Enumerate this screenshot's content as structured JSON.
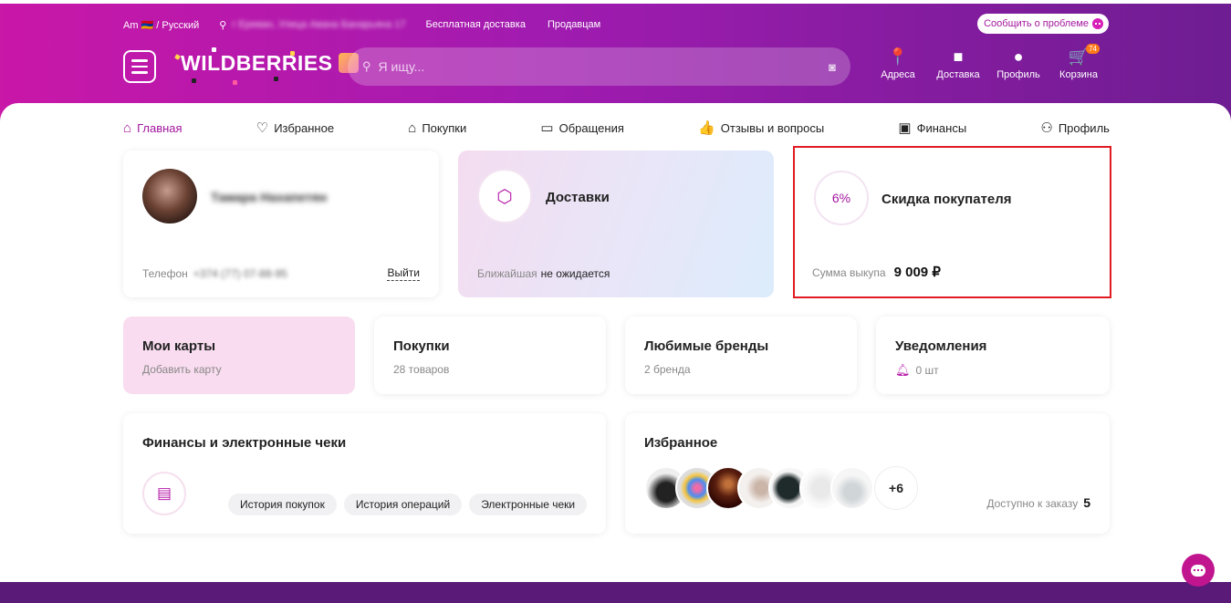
{
  "header": {
    "lang": "Am 🇦🇲 / Русский",
    "address": "г Ереван, Улица Авана Банарьяна 17",
    "links": [
      "Бесплатная доставка",
      "Продавцам"
    ],
    "report": "Сообщить о проблеме",
    "logo": "WILDBERRIES",
    "search_placeholder": "Я ищу...",
    "icons": [
      {
        "label": "Адреса",
        "icon": "map-pin-icon"
      },
      {
        "label": "Доставка",
        "icon": "box-icon"
      },
      {
        "label": "Профиль",
        "icon": "user-icon"
      },
      {
        "label": "Корзина",
        "icon": "cart-icon",
        "badge": "74"
      }
    ]
  },
  "tabs": [
    {
      "label": "Главная",
      "active": true
    },
    {
      "label": "Избранное"
    },
    {
      "label": "Покупки"
    },
    {
      "label": "Обращения"
    },
    {
      "label": "Отзывы и вопросы"
    },
    {
      "label": "Финансы"
    },
    {
      "label": "Профиль"
    }
  ],
  "profile": {
    "name": "Тамара Нахапетян",
    "phone_label": "Телефон",
    "phone": "+374 (77) 07-88-95",
    "logout": "Выйти"
  },
  "delivery": {
    "title": "Доставки",
    "nearest_label": "Ближайшая",
    "nearest_value": "не ожидается"
  },
  "discount": {
    "percent": "6%",
    "title": "Скидка покупателя",
    "sum_label": "Сумма выкупа",
    "sum_value": "9 009 ₽"
  },
  "small_cards": {
    "cards": {
      "title": "Мои карты",
      "sub": "Добавить карту"
    },
    "purchases": {
      "title": "Покупки",
      "sub": "28 товаров"
    },
    "brands": {
      "title": "Любимые бренды",
      "sub": "2 бренда"
    },
    "notifications": {
      "title": "Уведомления",
      "sub": "0 шт"
    }
  },
  "finance": {
    "title": "Финансы и электронные чеки",
    "chips": [
      "История покупок",
      "История операций",
      "Электронные чеки"
    ]
  },
  "favorites": {
    "title": "Избранное",
    "more": "+6",
    "avail_label": "Доступно к заказу",
    "avail_value": "5"
  }
}
